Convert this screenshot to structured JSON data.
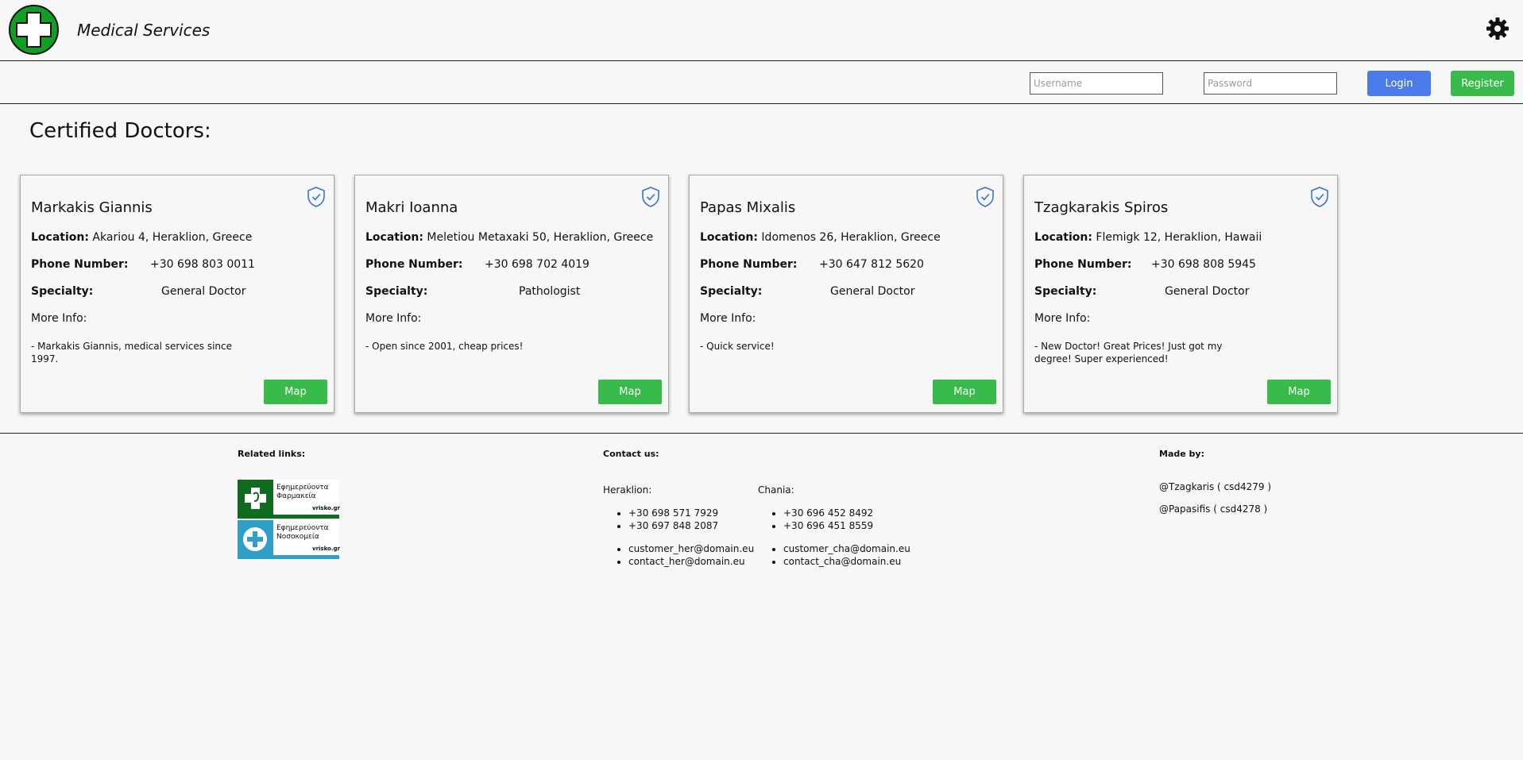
{
  "header": {
    "title": "Medical Services",
    "username_placeholder": "Username",
    "password_placeholder": "Password",
    "login_label": "Login",
    "register_label": "Register"
  },
  "main": {
    "heading": "Certified Doctors:",
    "labels": {
      "location": "Location:",
      "phone": "Phone Number:",
      "specialty": "Specialty:",
      "more_info": "More Info:",
      "map": "Map"
    },
    "doctors": [
      {
        "name": "Markakis Giannis",
        "location": "Akariou 4, Heraklion, Greece",
        "phone": "+30 698 803 0011",
        "specialty": "General Doctor",
        "info": "- Markakis Giannis, medical services since 1997."
      },
      {
        "name": "Makri Ioanna",
        "location": "Meletiou Metaxaki 50, Heraklion, Greece",
        "phone": "+30 698 702 4019",
        "specialty": "Pathologist",
        "info": "- Open since 2001, cheap prices!"
      },
      {
        "name": "Papas Mixalis",
        "location": "Idomenos 26, Heraklion, Greece",
        "phone": "+30 647 812 5620",
        "specialty": "General Doctor",
        "info": "- Quick service!"
      },
      {
        "name": "Tzagkarakis Spiros",
        "location": "Flemigk 12, Heraklion, Hawaii",
        "phone": "+30 698 808 5945",
        "specialty": "General Doctor",
        "info": "- New Doctor! Great Prices! Just got my degree! Super experienced!"
      }
    ]
  },
  "footer": {
    "related_heading": "Related links:",
    "links": [
      {
        "line1": "Εφημερεύοντα",
        "line2": "Φαρμακεία",
        "brand": "vrisko.gr",
        "color": "#0f6b1d"
      },
      {
        "line1": "Εφημερεύοντα",
        "line2": "Νοσοκομεία",
        "brand": "vrisko.gr",
        "color": "#2f9fc8"
      }
    ],
    "contact_heading": "Contact us:",
    "heraklion": {
      "label": "Heraklion:",
      "phones": [
        "+30 698 571 7929",
        "+30 697 848 2087"
      ],
      "emails": [
        "customer_her@domain.eu",
        "contact_her@domain.eu"
      ]
    },
    "chania": {
      "label": "Chania:",
      "phones": [
        "+30 696 452 8492",
        "+30 696 451 8559"
      ],
      "emails": [
        "customer_cha@domain.eu",
        "contact_cha@domain.eu"
      ]
    },
    "made_heading": "Made by:",
    "makers": [
      "@Tzagkaris ( csd4279 )",
      "@Papasifis ( csd4278 )"
    ]
  }
}
